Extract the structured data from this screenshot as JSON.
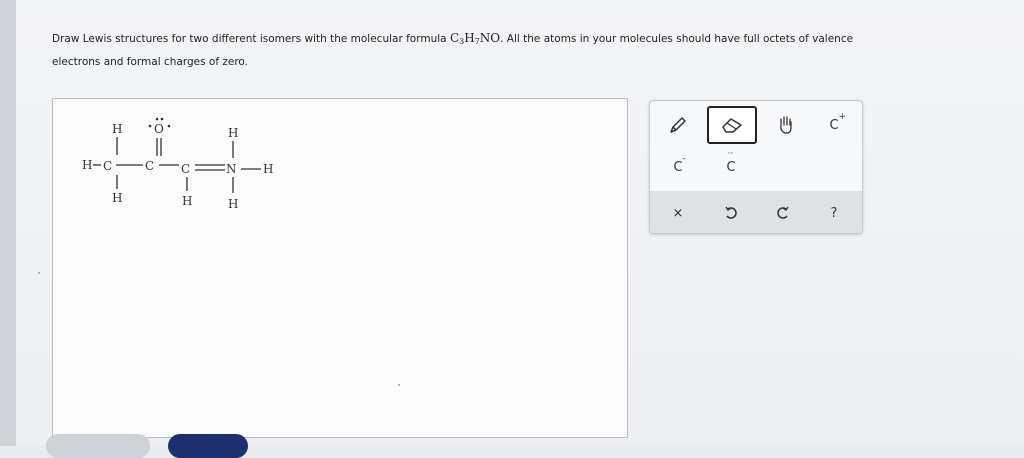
{
  "prompt": {
    "line1_prefix": "Draw Lewis structures for two different isomers with the molecular formula ",
    "formula_parts": [
      "C",
      "3",
      "H",
      "7",
      "NO"
    ],
    "line1_suffix": ". All the atoms in your molecules should have full octets of valence",
    "line2": "electrons and formal charges of zero."
  },
  "molecule": {
    "atoms": {
      "h_top_left": "H",
      "o_top": "O",
      "h_top_right": "H",
      "h_left": "H",
      "c1": "C",
      "c2": "C",
      "c3": "C",
      "n": "N",
      "h_right": "H",
      "h_bottom_left": "H",
      "h_bottom_mid": "H",
      "h_bottom_right": "H"
    }
  },
  "toolbox": {
    "tools": {
      "pencil": "pencil-icon",
      "eraser": "eraser-icon",
      "hand": "hand-icon",
      "positive_charge": {
        "symbol": "C",
        "charge": "+"
      },
      "negative_charge": {
        "symbol": "C",
        "charge": "-"
      },
      "lone_pair": {
        "symbol": "C",
        "dots": "··"
      }
    },
    "actions": {
      "clear": "×",
      "undo": "undo-icon",
      "redo": "redo-icon",
      "help": "?"
    },
    "selected_tool": "eraser"
  },
  "colors": {
    "primary_button": "#1c2f6e",
    "secondary_button": "#cfd3d8"
  }
}
